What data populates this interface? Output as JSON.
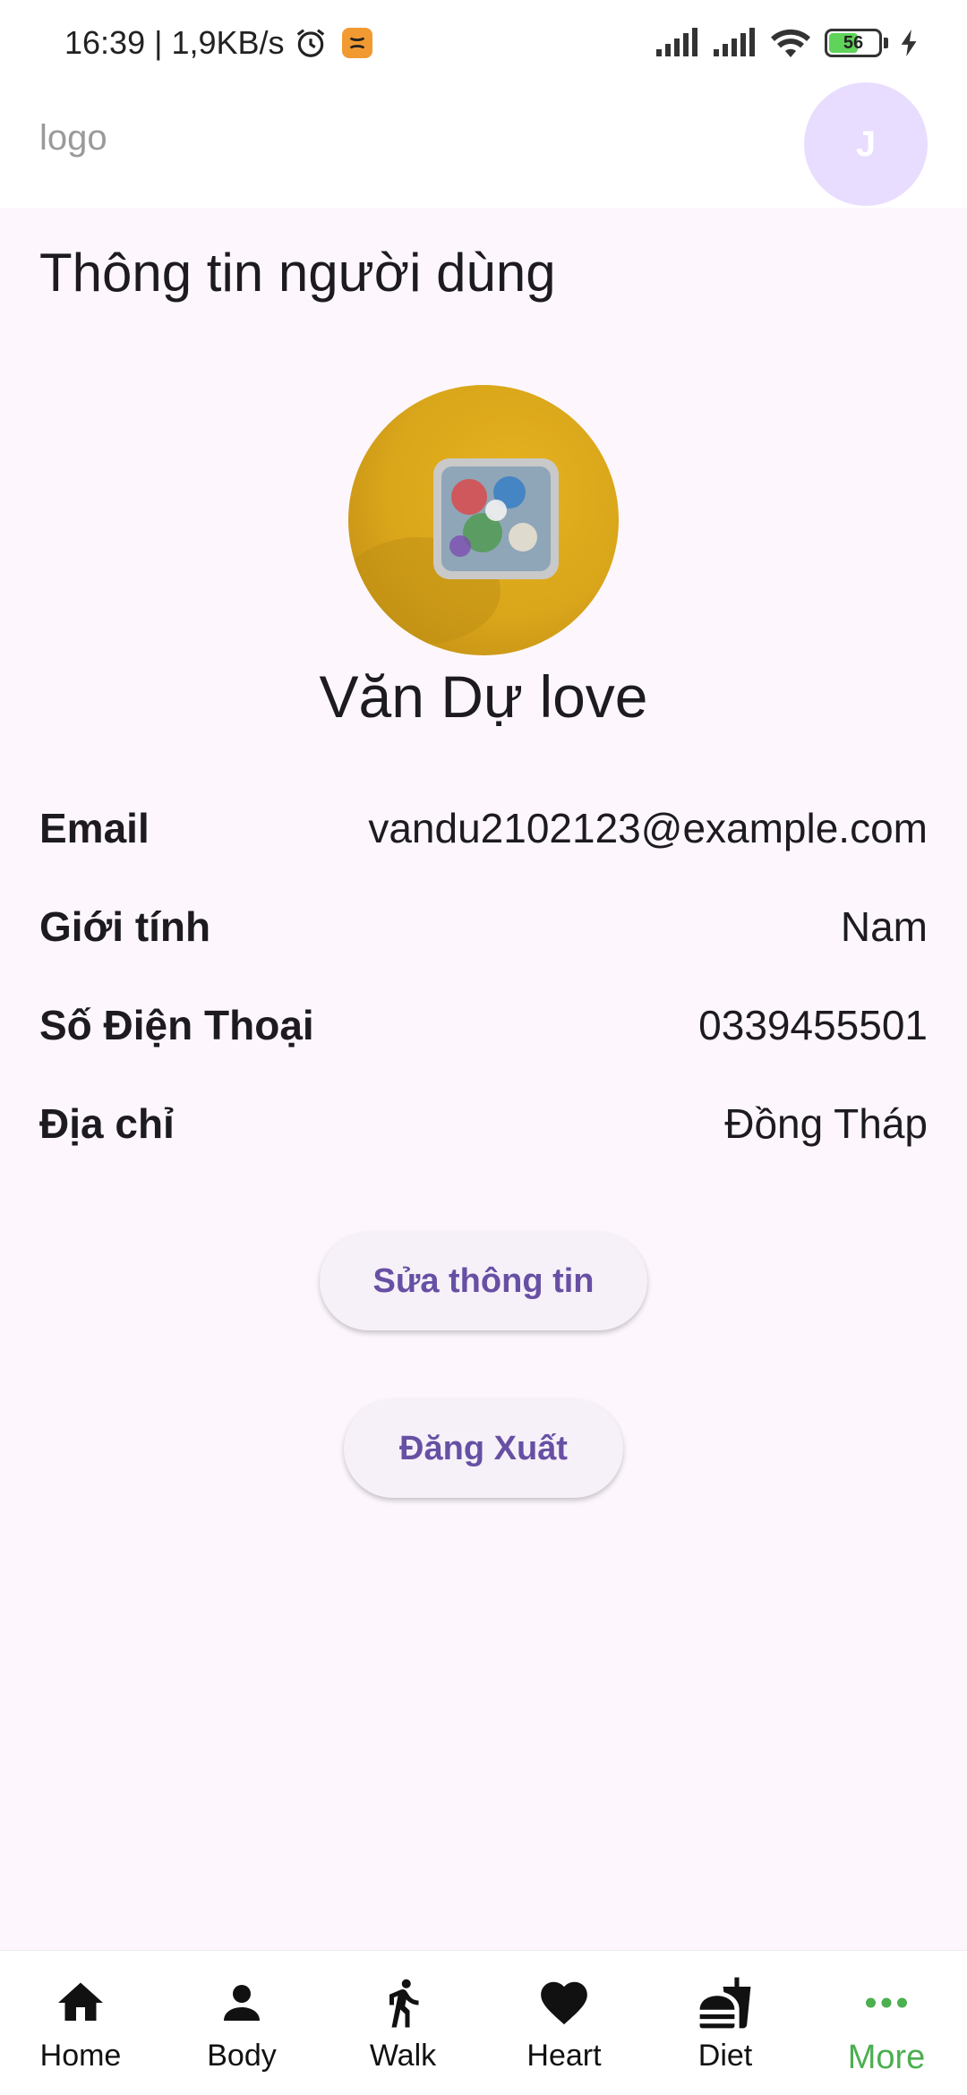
{
  "status_bar": {
    "time_speed": "16:39 | 1,9KB/s",
    "battery_level": "56",
    "battery_fraction": 0.56
  },
  "header": {
    "logo": "logo",
    "avatar_initial": "J"
  },
  "page": {
    "title": "Thông tin người dùng",
    "user_name": "Văn Dự love"
  },
  "info": [
    {
      "label": "Email",
      "value": "vandu2102123@example.com"
    },
    {
      "label": "Giới tính",
      "value": "Nam"
    },
    {
      "label": "Số Điện Thoại",
      "value": "0339455501"
    },
    {
      "label": "Địa chỉ",
      "value": "Đồng Tháp"
    }
  ],
  "buttons": {
    "edit": "Sửa thông tin",
    "logout": "Đăng Xuất"
  },
  "nav": [
    {
      "label": "Home",
      "icon": "home-icon"
    },
    {
      "label": "Body",
      "icon": "person-icon"
    },
    {
      "label": "Walk",
      "icon": "walk-icon"
    },
    {
      "label": "Heart",
      "icon": "heart-icon"
    },
    {
      "label": "Diet",
      "icon": "fastfood-icon"
    },
    {
      "label": "More",
      "icon": "more-icon"
    }
  ],
  "colors": {
    "accent": "#6750a4",
    "active_nav": "#4caf50",
    "avatar_bg": "#e8ddff",
    "background": "#fdf7fd"
  }
}
